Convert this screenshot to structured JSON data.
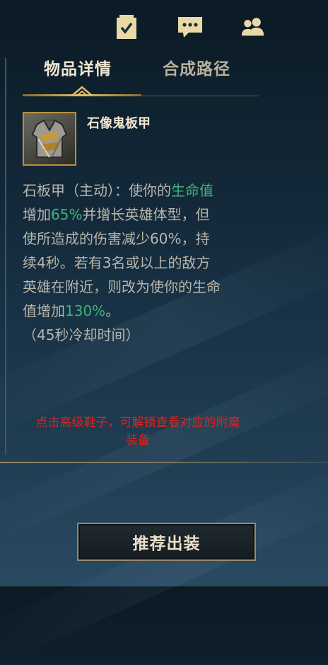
{
  "toolbar": {
    "icons": [
      "tasks-icon",
      "chat-icon",
      "friends-icon"
    ],
    "accent": "#f0e6d2"
  },
  "tabs": [
    {
      "label": "物品详情",
      "active": true
    },
    {
      "label": "合成路径",
      "active": false
    }
  ],
  "item": {
    "name": "石像鬼板甲",
    "icon": "armor-icon"
  },
  "description": {
    "line1": {
      "a": "石板甲（主动）：使你的",
      "b": "生命值"
    },
    "line2": {
      "a": "增加",
      "b": "65%",
      "c": "并增长英雄体型，但"
    },
    "line3": "使所造成的伤害减少60%，持",
    "line4": "续4秒。若有3名或以上的敌方",
    "line5": "英雄在附近，则改为使你的生命",
    "line6": {
      "a": "值增加",
      "b": "130%",
      "c": "。"
    },
    "line7": "（45秒冷却时间）"
  },
  "note": {
    "line1": "点击高级鞋子，可解锁查看对应的附魔",
    "line2": "装备"
  },
  "recommend_button": {
    "label": "推荐出装"
  },
  "colors": {
    "highlight": "#3fb378",
    "note": "#d8261e",
    "gold": "#c8aa6e",
    "text": "#b9b5ab"
  }
}
